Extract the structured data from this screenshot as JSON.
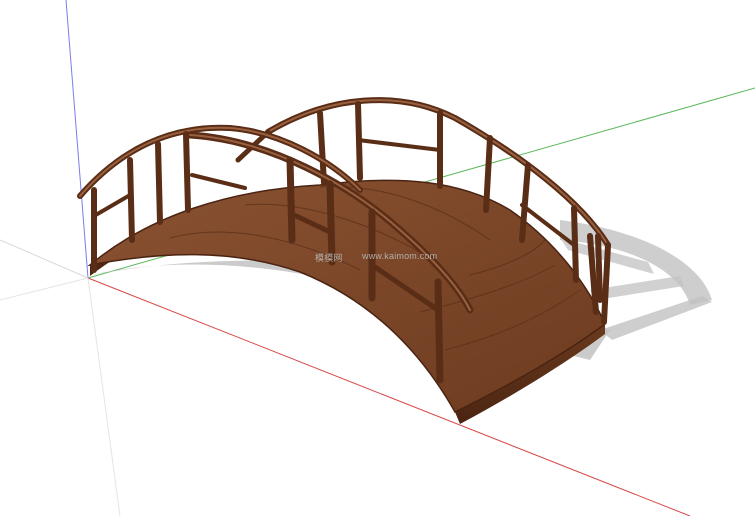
{
  "app": {
    "type": "3D modeling viewport"
  },
  "colors": {
    "background": "#ffffff",
    "axis_red": "#d93a3a",
    "axis_green": "#48b048",
    "axis_blue": "#6a6af0",
    "wood_dark": "#5a2d16",
    "wood_mid": "#7b4526",
    "wood_light": "#9a6140",
    "shadow": "#c4c4c4"
  },
  "model": {
    "name_icon": "arched-wooden-bridge-model"
  },
  "watermark": {
    "cn": "模模网",
    "url": "www.kaimom.com"
  }
}
